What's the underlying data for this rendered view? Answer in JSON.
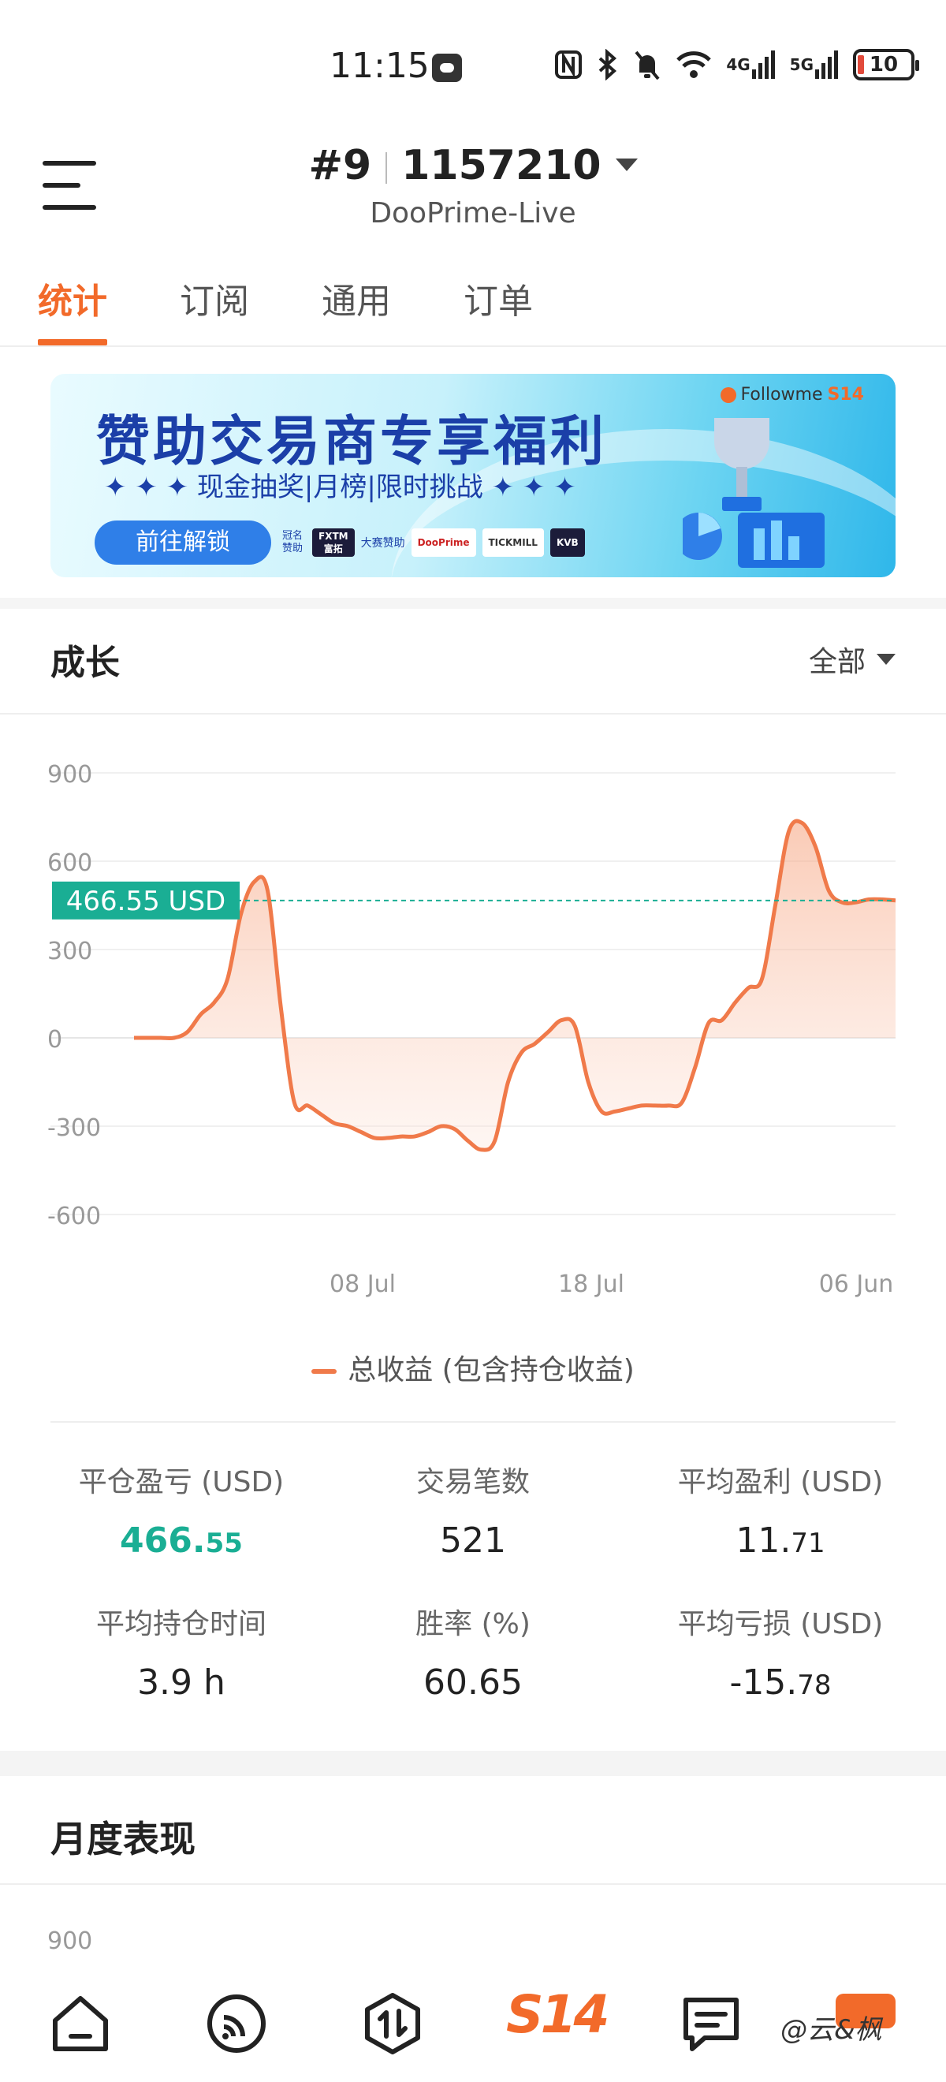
{
  "status_bar": {
    "time": "11:15",
    "network_4g": "4G",
    "network_5g": "5G",
    "battery": "10"
  },
  "header": {
    "account_index": "#9",
    "account_number": "1157210",
    "server": "DooPrime-Live"
  },
  "tabs": [
    {
      "label": "统计",
      "active": true
    },
    {
      "label": "订阅",
      "active": false
    },
    {
      "label": "通用",
      "active": false
    },
    {
      "label": "订单",
      "active": false
    }
  ],
  "banner": {
    "title": "赞助交易商专享福利",
    "subtitle": "现金抽奖|月榜|限时挑战",
    "button": "前往解锁",
    "brand": "Followme",
    "brand_tag": "S14",
    "sponsor_label": "冠名赞助",
    "sponsor_title": "FXTM",
    "sponsor_title_sub": "富拓",
    "event_sponsor_label": "大赛赞助",
    "sponsors": [
      "DooPrime",
      "TICKMILL",
      "KVB"
    ]
  },
  "growth": {
    "title": "成长",
    "filter": "全部"
  },
  "chart_data": {
    "type": "area",
    "yticks": [
      900,
      600,
      300,
      0,
      -300,
      -600
    ],
    "ylim": [
      -600,
      900
    ],
    "xticks": [
      "08 Jul",
      "18 Jul",
      "06 Jun"
    ],
    "current_label": "466.55 USD",
    "current_value": 466.55,
    "series": [
      {
        "name": "总收益 (包含持仓收益)",
        "color": "#f07a4a",
        "values": [
          0,
          0,
          0,
          0,
          20,
          80,
          120,
          200,
          420,
          530,
          500,
          100,
          -220,
          -230,
          -260,
          -290,
          -300,
          -320,
          -340,
          -340,
          -335,
          -335,
          -320,
          -300,
          -310,
          -350,
          -380,
          -350,
          -150,
          -50,
          -20,
          20,
          60,
          40,
          -150,
          -250,
          -250,
          -240,
          -230,
          -230,
          -230,
          -220,
          -100,
          50,
          60,
          120,
          170,
          200,
          450,
          700,
          730,
          650,
          500,
          460,
          460,
          470,
          470,
          466.55
        ]
      }
    ],
    "legend": "总收益 (包含持仓收益)"
  },
  "stats": [
    {
      "label": "平仓盈亏 (USD)",
      "value_main": "466.",
      "value_dec": "55",
      "green": true
    },
    {
      "label": "交易笔数",
      "value_main": "521",
      "value_dec": "",
      "green": false
    },
    {
      "label": "平均盈利 (USD)",
      "value_main": "11.",
      "value_dec": "71",
      "green": false
    },
    {
      "label": "平均持仓时间",
      "value_main": "3.9 h",
      "value_dec": "",
      "green": false
    },
    {
      "label": "胜率 (%)",
      "value_main": "60.65",
      "value_dec": "",
      "green": false
    },
    {
      "label": "平均亏损 (USD)",
      "value_main": "-15.",
      "value_dec": "78",
      "green": false
    }
  ],
  "monthly": {
    "title": "月度表现",
    "first_tick": "900"
  },
  "bottom_nav": {
    "items": [
      "home-icon",
      "feed-icon",
      "trade-icon",
      "s14-logo",
      "message-icon",
      "profile-icon"
    ],
    "s14_label": "S14"
  },
  "watermark": "@云&枫"
}
